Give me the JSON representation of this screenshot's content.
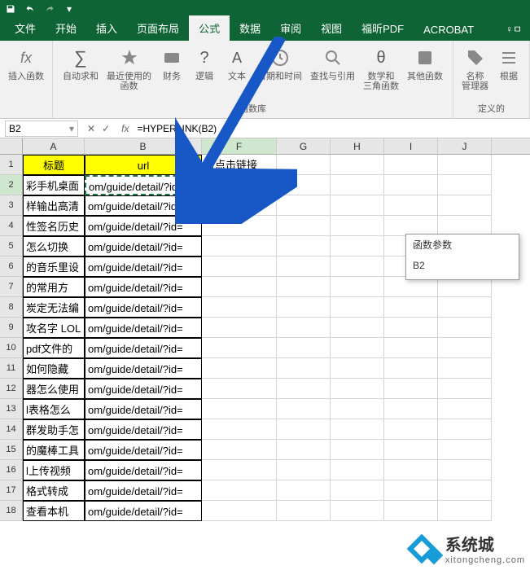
{
  "titlebar": {
    "save_icon": "save-icon",
    "undo_icon": "undo-icon",
    "redo_icon": "redo-icon"
  },
  "tabs": {
    "file": "文件",
    "home": "开始",
    "insert": "插入",
    "layout": "页面布局",
    "formula": "公式",
    "data": "数据",
    "review": "审阅",
    "view": "视图",
    "foxit": "福昕PDF",
    "acrobat": "ACROBAT",
    "help": "♀ㅁ"
  },
  "ribbon": {
    "insert_fn": "插入函数",
    "autosum": "自动求和",
    "recent": "最近使用的\n函数",
    "financial": "财务",
    "logical": "逻辑",
    "text": "文本",
    "datetime": "日期和时间",
    "lookup": "查找与引用",
    "math": "数学和\n三角函数",
    "other": "其他函数",
    "name_mgr": "名称\n管理器",
    "from_sel": "根据",
    "group_lib": "函数库",
    "group_names": "定义的"
  },
  "namebox": "B2",
  "formula": "=HYPERLINK(B2)",
  "cols": {
    "A_w": 76,
    "B_w": 144,
    "F_w": 92,
    "other_w": 66
  },
  "headers": {
    "A": "标题",
    "B": "url",
    "F": "可点击链接"
  },
  "colA": [
    "彩手机桌面",
    "样输出高清",
    "性签名历史",
    "怎么切换",
    "的音乐里设",
    "的常用方",
    "炭定无法编",
    "攻名字 LOL",
    "pdf文件的",
    "如何隐藏",
    "器怎么使用",
    "l表格怎么",
    "群发助手怎",
    "的魔棒工具",
    "l上传视频",
    "格式转成",
    "查看本机"
  ],
  "colB": "om/guide/detail/?id=",
  "cellF2": "RLINK(B2)",
  "popup": {
    "title": "函数参数",
    "arg": "B2"
  },
  "watermark": {
    "brand": "系统城",
    "sub": "xitongcheng.com"
  },
  "chart_data": {
    "type": "table",
    "columns": [
      "标题",
      "url",
      "可点击链接"
    ],
    "rows": [
      [
        "彩手机桌面",
        "om/guide/detail/?id=",
        "=HYPERLINK(B2)"
      ],
      [
        "样输出高清",
        "om/guide/detail/?id=",
        ""
      ],
      [
        "性签名历史",
        "om/guide/detail/?id=",
        ""
      ],
      [
        "怎么切换",
        "om/guide/detail/?id=",
        ""
      ],
      [
        "的音乐里设",
        "om/guide/detail/?id=",
        ""
      ],
      [
        "的常用方",
        "om/guide/detail/?id=",
        ""
      ],
      [
        "炭定无法编",
        "om/guide/detail/?id=",
        ""
      ],
      [
        "攻名字 LOL",
        "om/guide/detail/?id=",
        ""
      ],
      [
        "pdf文件的",
        "om/guide/detail/?id=",
        ""
      ],
      [
        "如何隐藏",
        "om/guide/detail/?id=",
        ""
      ],
      [
        "器怎么使用",
        "om/guide/detail/?id=",
        ""
      ],
      [
        "l表格怎么",
        "om/guide/detail/?id=",
        ""
      ],
      [
        "群发助手怎",
        "om/guide/detail/?id=",
        ""
      ],
      [
        "的魔棒工具",
        "om/guide/detail/?id=",
        ""
      ],
      [
        "l上传视频",
        "om/guide/detail/?id=",
        ""
      ],
      [
        "格式转成",
        "om/guide/detail/?id=",
        ""
      ],
      [
        "查看本机",
        "om/guide/detail/?id=",
        ""
      ]
    ]
  }
}
